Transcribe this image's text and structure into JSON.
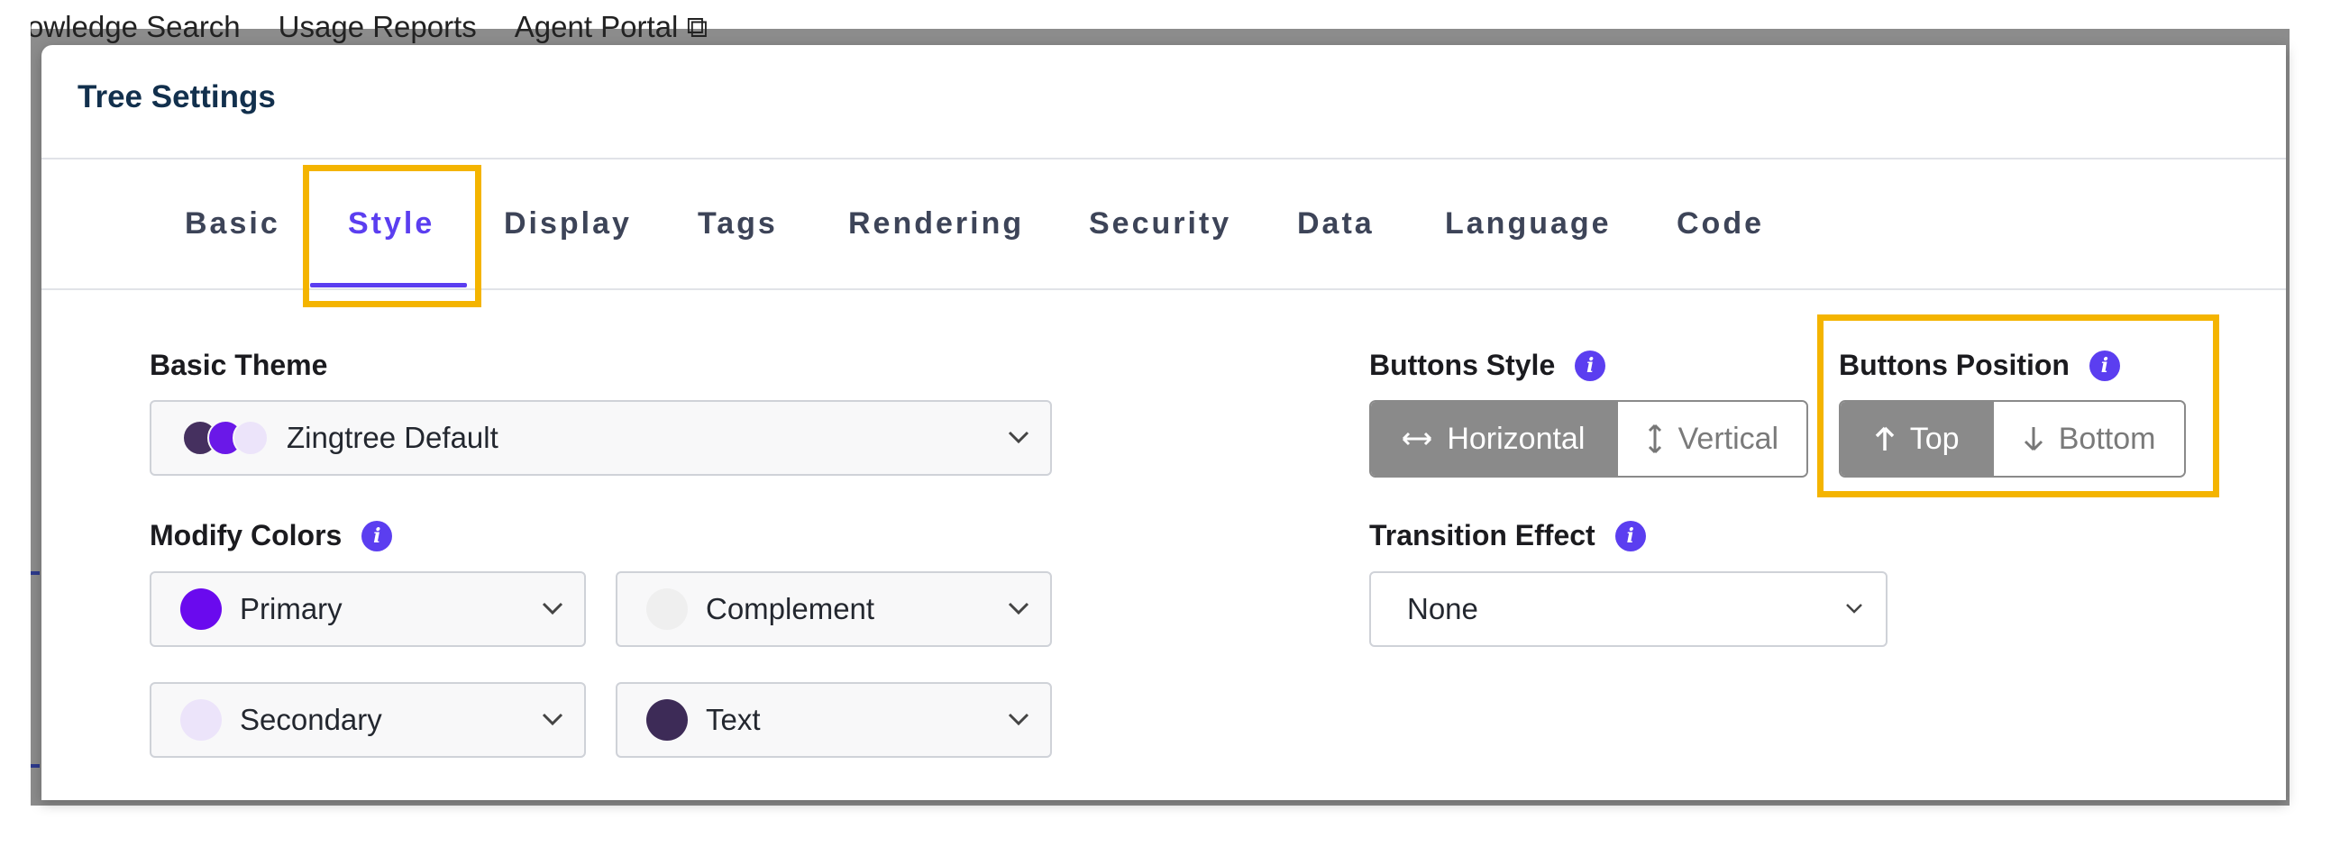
{
  "background_nav": {
    "items": [
      "owledge Search",
      "Usage Reports",
      "Agent Portal"
    ]
  },
  "modal": {
    "title": "Tree Settings"
  },
  "tabs": [
    {
      "label": "Basic",
      "active": false
    },
    {
      "label": "Style",
      "active": true
    },
    {
      "label": "Display",
      "active": false
    },
    {
      "label": "Tags",
      "active": false
    },
    {
      "label": "Rendering",
      "active": false
    },
    {
      "label": "Security",
      "active": false
    },
    {
      "label": "Data",
      "active": false
    },
    {
      "label": "Language",
      "active": false
    },
    {
      "label": "Code",
      "active": false
    }
  ],
  "basic_theme": {
    "label": "Basic Theme",
    "value": "Zingtree Default",
    "dot_colors": [
      "#45305f",
      "#6a18e8",
      "#ece4fa"
    ]
  },
  "modify_colors": {
    "label": "Modify Colors",
    "options": [
      {
        "label": "Primary",
        "color": "#6a0aee"
      },
      {
        "label": "Complement",
        "color": "#efefef"
      },
      {
        "label": "Secondary",
        "color": "#ece4fa"
      },
      {
        "label": "Text",
        "color": "#3d2b57"
      }
    ]
  },
  "buttons_style": {
    "label": "Buttons Style",
    "options": [
      {
        "label": "Horizontal",
        "icon": "horizontal-arrows-icon",
        "selected": true
      },
      {
        "label": "Vertical",
        "icon": "vertical-arrows-icon",
        "selected": false
      }
    ]
  },
  "buttons_position": {
    "label": "Buttons Position",
    "options": [
      {
        "label": "Top",
        "icon": "arrow-up-icon",
        "selected": true
      },
      {
        "label": "Bottom",
        "icon": "arrow-down-icon",
        "selected": false
      }
    ]
  },
  "transition_effect": {
    "label": "Transition Effect",
    "value": "None"
  },
  "colors": {
    "accent": "#5b3ef0",
    "highlight": "#f4b400",
    "title": "#12304d"
  }
}
